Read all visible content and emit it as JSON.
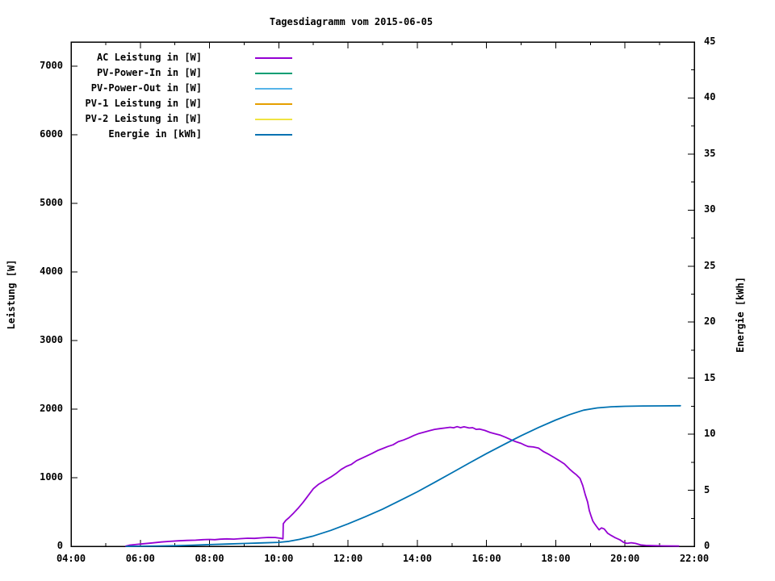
{
  "title": "Tagesdiagramm vom 2015-06-05",
  "axes": {
    "x": {
      "tick_labels": [
        "04:00",
        "06:00",
        "08:00",
        "10:00",
        "12:00",
        "14:00",
        "16:00",
        "18:00",
        "20:00",
        "22:00"
      ],
      "major_hours": [
        4,
        6,
        8,
        10,
        12,
        14,
        16,
        18,
        20,
        22
      ],
      "minor_hours": [
        5,
        7,
        9,
        11,
        13,
        15,
        17,
        19,
        21
      ]
    },
    "y1": {
      "label": "Leistung [W]",
      "tick_values": [
        0,
        1000,
        2000,
        3000,
        4000,
        5000,
        6000,
        7000
      ],
      "tick_labels": [
        "0",
        "1000",
        "2000",
        "3000",
        "4000",
        "5000",
        "6000",
        "7000"
      ]
    },
    "y2": {
      "label": "Energie [kWh]",
      "tick_values": [
        0,
        5,
        10,
        15,
        20,
        25,
        30,
        35,
        40,
        45
      ],
      "tick_labels": [
        "0",
        "5",
        "10",
        "15",
        "20",
        "25",
        "30",
        "35",
        "40",
        "45"
      ],
      "minor_values": [
        2.5,
        7.5,
        12.5,
        17.5,
        22.5,
        27.5,
        32.5,
        37.5,
        42.5
      ]
    }
  },
  "legend": {
    "items": [
      {
        "label": "AC Leistung in [W]",
        "color": "#9400D3"
      },
      {
        "label": "PV-Power-In in [W]",
        "color": "#009E73"
      },
      {
        "label": "PV-Power-Out in [W]",
        "color": "#56B4E9"
      },
      {
        "label": "PV-1 Leistung in [W]",
        "color": "#E69F00"
      },
      {
        "label": "PV-2 Leistung in [W]",
        "color": "#F0E442"
      },
      {
        "label": "Energie in [kWh]",
        "color": "#0072B2"
      }
    ]
  },
  "chart_data": {
    "type": "line",
    "title": "Tagesdiagramm vom 2015-06-05",
    "x_range_hours": [
      4,
      22
    ],
    "y1_range": [
      0,
      7353
    ],
    "y2_range": [
      0,
      45
    ],
    "y1_label": "Leistung [W]",
    "y2_label": "Energie [kWh]",
    "grid": false,
    "legend_position": "top-left-inside",
    "series": [
      {
        "name": "AC Leistung in [W]",
        "color": "#9400D3",
        "axis": "y1",
        "points": [
          [
            5.58,
            2
          ],
          [
            5.7,
            18
          ],
          [
            5.9,
            28
          ],
          [
            6.1,
            38
          ],
          [
            6.35,
            50
          ],
          [
            6.6,
            62
          ],
          [
            6.85,
            72
          ],
          [
            7.1,
            80
          ],
          [
            7.35,
            86
          ],
          [
            7.6,
            90
          ],
          [
            7.8,
            96
          ],
          [
            8.0,
            100
          ],
          [
            8.15,
            97
          ],
          [
            8.3,
            104
          ],
          [
            8.5,
            108
          ],
          [
            8.7,
            105
          ],
          [
            8.9,
            112
          ],
          [
            9.1,
            118
          ],
          [
            9.3,
            115
          ],
          [
            9.5,
            124
          ],
          [
            9.7,
            130
          ],
          [
            9.9,
            128
          ],
          [
            10.05,
            118
          ],
          [
            10.12,
            110
          ],
          [
            10.13,
            330
          ],
          [
            10.2,
            375
          ],
          [
            10.3,
            420
          ],
          [
            10.42,
            480
          ],
          [
            10.55,
            550
          ],
          [
            10.7,
            640
          ],
          [
            10.85,
            740
          ],
          [
            11.0,
            840
          ],
          [
            11.15,
            905
          ],
          [
            11.35,
            965
          ],
          [
            11.5,
            1010
          ],
          [
            11.65,
            1060
          ],
          [
            11.8,
            1120
          ],
          [
            11.95,
            1165
          ],
          [
            12.1,
            1195
          ],
          [
            12.25,
            1250
          ],
          [
            12.4,
            1285
          ],
          [
            12.55,
            1320
          ],
          [
            12.7,
            1355
          ],
          [
            12.85,
            1395
          ],
          [
            13.0,
            1425
          ],
          [
            13.15,
            1455
          ],
          [
            13.3,
            1480
          ],
          [
            13.45,
            1525
          ],
          [
            13.6,
            1550
          ],
          [
            13.75,
            1580
          ],
          [
            13.9,
            1615
          ],
          [
            14.05,
            1645
          ],
          [
            14.2,
            1665
          ],
          [
            14.35,
            1685
          ],
          [
            14.5,
            1705
          ],
          [
            14.65,
            1715
          ],
          [
            14.8,
            1725
          ],
          [
            14.95,
            1735
          ],
          [
            15.05,
            1728
          ],
          [
            15.15,
            1745
          ],
          [
            15.25,
            1730
          ],
          [
            15.35,
            1742
          ],
          [
            15.5,
            1725
          ],
          [
            15.6,
            1730
          ],
          [
            15.7,
            1705
          ],
          [
            15.8,
            1710
          ],
          [
            15.95,
            1690
          ],
          [
            16.1,
            1660
          ],
          [
            16.25,
            1640
          ],
          [
            16.4,
            1620
          ],
          [
            16.55,
            1590
          ],
          [
            16.7,
            1555
          ],
          [
            16.85,
            1525
          ],
          [
            17.0,
            1500
          ],
          [
            17.1,
            1475
          ],
          [
            17.2,
            1455
          ],
          [
            17.35,
            1448
          ],
          [
            17.5,
            1432
          ],
          [
            17.65,
            1380
          ],
          [
            17.8,
            1340
          ],
          [
            17.95,
            1295
          ],
          [
            18.1,
            1250
          ],
          [
            18.25,
            1200
          ],
          [
            18.4,
            1125
          ],
          [
            18.5,
            1080
          ],
          [
            18.6,
            1040
          ],
          [
            18.7,
            990
          ],
          [
            18.78,
            885
          ],
          [
            18.85,
            755
          ],
          [
            18.92,
            645
          ],
          [
            18.97,
            520
          ],
          [
            19.02,
            440
          ],
          [
            19.07,
            370
          ],
          [
            19.12,
            330
          ],
          [
            19.18,
            287
          ],
          [
            19.25,
            240
          ],
          [
            19.32,
            268
          ],
          [
            19.4,
            252
          ],
          [
            19.5,
            190
          ],
          [
            19.6,
            158
          ],
          [
            19.72,
            125
          ],
          [
            19.85,
            95
          ],
          [
            19.95,
            60
          ],
          [
            20.05,
            42
          ],
          [
            20.18,
            52
          ],
          [
            20.3,
            42
          ],
          [
            20.45,
            20
          ],
          [
            20.6,
            13
          ],
          [
            20.8,
            9
          ],
          [
            21.1,
            6
          ],
          [
            21.55,
            4
          ]
        ]
      },
      {
        "name": "PV-Power-In in [W]",
        "color": "#009E73",
        "axis": "y1",
        "points": []
      },
      {
        "name": "PV-Power-Out in [W]",
        "color": "#56B4E9",
        "axis": "y1",
        "points": []
      },
      {
        "name": "PV-1 Leistung in [W]",
        "color": "#E69F00",
        "axis": "y1",
        "points": []
      },
      {
        "name": "PV-2 Leistung in [W]",
        "color": "#F0E442",
        "axis": "y1",
        "points": []
      },
      {
        "name": "Energie in [kWh]",
        "color": "#0072B2",
        "axis": "y2",
        "points": [
          [
            5.6,
            0
          ],
          [
            6.5,
            0.03
          ],
          [
            7.0,
            0.05
          ],
          [
            7.5,
            0.1
          ],
          [
            8.0,
            0.15
          ],
          [
            8.5,
            0.2
          ],
          [
            9.0,
            0.25
          ],
          [
            9.5,
            0.3
          ],
          [
            10.0,
            0.35
          ],
          [
            10.3,
            0.45
          ],
          [
            10.6,
            0.62
          ],
          [
            11.0,
            0.92
          ],
          [
            11.5,
            1.42
          ],
          [
            12.0,
            2.0
          ],
          [
            12.5,
            2.64
          ],
          [
            13.0,
            3.32
          ],
          [
            13.5,
            4.08
          ],
          [
            14.0,
            4.86
          ],
          [
            14.5,
            5.7
          ],
          [
            15.0,
            6.56
          ],
          [
            15.5,
            7.42
          ],
          [
            16.0,
            8.27
          ],
          [
            16.5,
            9.08
          ],
          [
            17.0,
            9.87
          ],
          [
            17.5,
            10.6
          ],
          [
            18.0,
            11.27
          ],
          [
            18.4,
            11.75
          ],
          [
            18.8,
            12.15
          ],
          [
            19.2,
            12.35
          ],
          [
            19.6,
            12.45
          ],
          [
            20.0,
            12.49
          ],
          [
            20.5,
            12.52
          ],
          [
            21.0,
            12.53
          ],
          [
            21.6,
            12.54
          ]
        ]
      }
    ]
  }
}
